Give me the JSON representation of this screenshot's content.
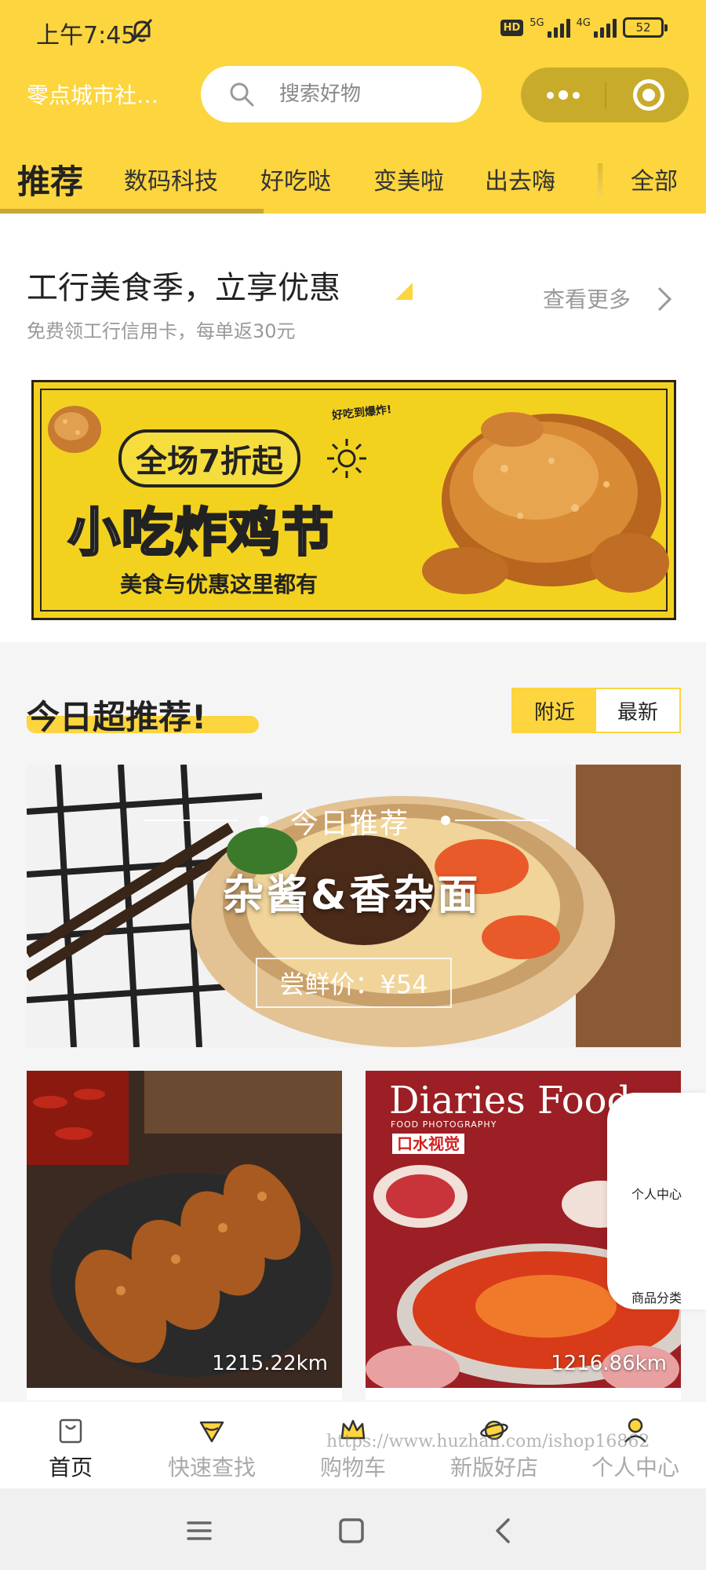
{
  "status_bar": {
    "time": "上午7:45",
    "hd": "HD",
    "net_5g": "5G",
    "net_4g": "4G",
    "battery": "52"
  },
  "header": {
    "city": "零点城市社…",
    "search_placeholder": "搜索好物",
    "tabs": [
      "推荐",
      "数码科技",
      "好吃哒",
      "变美啦",
      "出去嗨",
      "全部"
    ],
    "active_tab": "推荐",
    "accent_color": "#fcd53f"
  },
  "promo": {
    "title": "工行美食季，立享优惠",
    "subtitle": "免费领工行信用卡，每单返30元",
    "more_label": "查看更多",
    "banner": {
      "tag": "好吃到爆炸!",
      "pill": "全场7折起",
      "main": "小吃炸鸡节",
      "sub": "美食与优惠这里都有"
    }
  },
  "today": {
    "title": "今日超推荐!",
    "segments": [
      "附近",
      "最新"
    ],
    "active_segment": "附近",
    "feature": {
      "tag": "今日推荐",
      "name": "杂酱&香杂面",
      "price": "尝鲜价：¥54"
    },
    "cards": [
      {
        "distance": "1215.22km"
      },
      {
        "title": "Diaries Food",
        "sub": "FOOD PHOTOGRAPHY",
        "badge": "口水视觉",
        "distance": "1216.86km"
      }
    ]
  },
  "float_panel": {
    "items": [
      "个人中心",
      "商品分类"
    ]
  },
  "tabbar": {
    "items": [
      {
        "label": "首页",
        "icon": "bag-icon"
      },
      {
        "label": "快速查找",
        "icon": "gem-icon"
      },
      {
        "label": "购物车",
        "icon": "crown-icon"
      },
      {
        "label": "新版好店",
        "icon": "planet-icon"
      },
      {
        "label": "个人中心",
        "icon": "user-icon"
      }
    ],
    "active": "首页"
  },
  "watermark": "https://www.huzhan.com/ishop16862"
}
